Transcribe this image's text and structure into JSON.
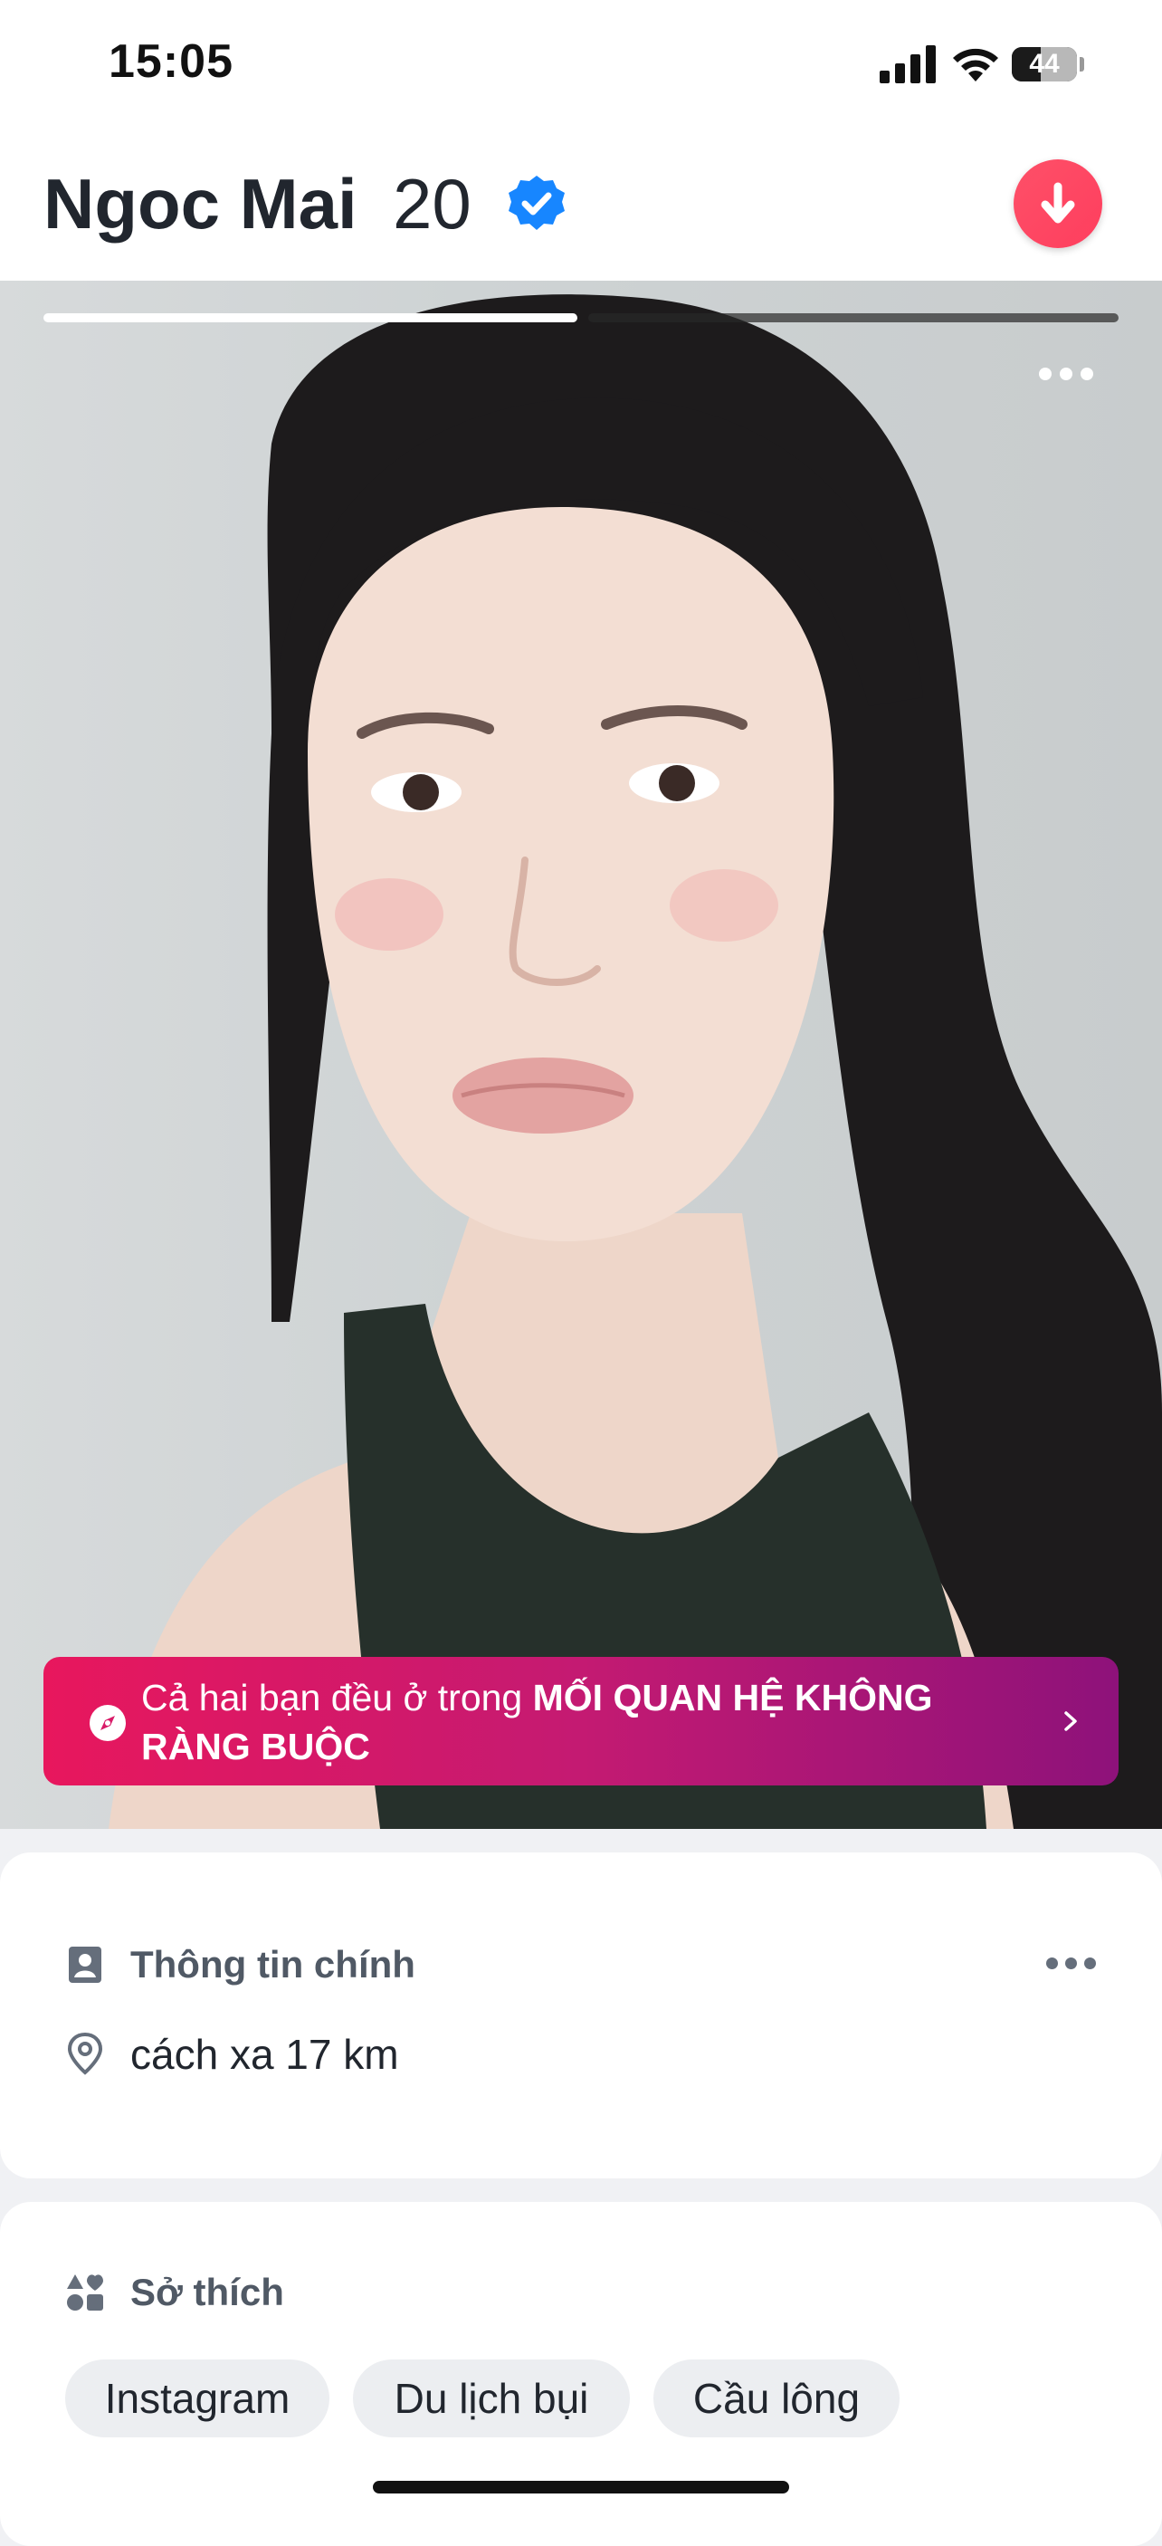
{
  "status_bar": {
    "time": "15:05",
    "battery": "44"
  },
  "profile": {
    "name": "Ngoc Mai",
    "age": "20",
    "verified": true
  },
  "photo": {
    "count": 2,
    "active_index": 0
  },
  "relationship_banner": {
    "prefix": "Cả hai bạn đều ở trong ",
    "highlight": "MỐI QUAN HỆ KHÔNG RÀNG BUỘC",
    "gradient": [
      "#e8175d",
      "#8e127a"
    ]
  },
  "main_info": {
    "title": "Thông tin chính",
    "distance": "cách xa 17 km"
  },
  "interests": {
    "title": "Sở thích",
    "items": [
      "Instagram",
      "Du lịch bụi",
      "Cầu lông"
    ]
  },
  "icons": {
    "verified": "verified-badge-icon",
    "collapse": "arrow-down-icon",
    "more": "more-dots-icon",
    "relationship": "compass-icon",
    "main_info": "id-card-icon",
    "location": "location-pin-icon",
    "interests": "shapes-icon"
  },
  "colors": {
    "brand_red": "#fd5068",
    "verified_blue": "#1786ff",
    "text": "#21262e"
  }
}
